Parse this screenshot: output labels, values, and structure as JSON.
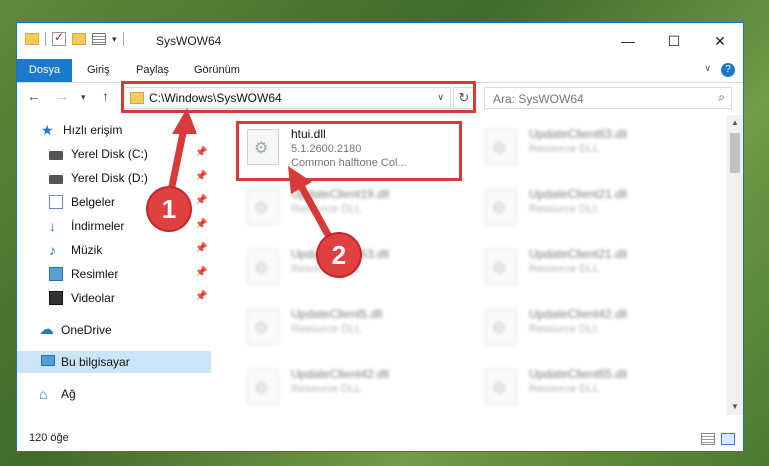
{
  "window": {
    "title": "SysWOW64",
    "controls": {
      "minimize": "—",
      "maximize": "☐",
      "close": "✕"
    }
  },
  "ribbon": {
    "tabs": [
      "Dosya",
      "Giriş",
      "Paylaş",
      "Görünüm"
    ],
    "help": "?"
  },
  "address": {
    "path": "C:\\Windows\\SysWOW64",
    "search_placeholder": "Ara: SysWOW64"
  },
  "nav_pane": {
    "items": [
      {
        "label": "Hızlı erişim",
        "icon": "star-icon"
      },
      {
        "label": "Yerel Disk (C:)",
        "icon": "drive-icon",
        "pinned": true
      },
      {
        "label": "Yerel Disk (D:)",
        "icon": "drive-icon",
        "pinned": true
      },
      {
        "label": "Belgeler",
        "icon": "documents-icon",
        "pinned": true
      },
      {
        "label": "İndirmeler",
        "icon": "download-icon",
        "pinned": true
      },
      {
        "label": "Müzik",
        "icon": "music-icon",
        "pinned": true
      },
      {
        "label": "Resimler",
        "icon": "pictures-icon",
        "pinned": true
      },
      {
        "label": "Videolar",
        "icon": "videos-icon",
        "pinned": true
      },
      {
        "label": "OneDrive",
        "icon": "onedrive-icon"
      },
      {
        "label": "Bu bilgisayar",
        "icon": "computer-icon",
        "selected": true
      },
      {
        "label": "Ağ",
        "icon": "network-icon"
      }
    ]
  },
  "files": [
    {
      "name": "htui.dll",
      "version": "5.1.2600.2180",
      "desc": "Common halftone Col..."
    },
    {
      "name": "UpdateClient63.dll",
      "desc": "Resource DLL"
    },
    {
      "name": "UpdateClient19.dll",
      "desc": "Resource DLL"
    },
    {
      "name": "UpdateClient21.dll",
      "desc": "Resource DLL"
    },
    {
      "name": "UpdateClient63.dll",
      "desc": "Resource DLL"
    },
    {
      "name": "UpdateClient21.dll",
      "desc": "Resource DLL"
    },
    {
      "name": "UpdateClient5.dll",
      "desc": "Resource DLL"
    },
    {
      "name": "UpdateClient42.dll",
      "desc": "Resource DLL"
    },
    {
      "name": "UpdateClient42.dll",
      "desc": "Resource DLL"
    },
    {
      "name": "UpdateClient65.dll",
      "desc": "Resource DLL"
    }
  ],
  "status": {
    "count": "120 öğe"
  },
  "annotations": {
    "step1": "1",
    "step2": "2",
    "color": "#d83a3a"
  }
}
